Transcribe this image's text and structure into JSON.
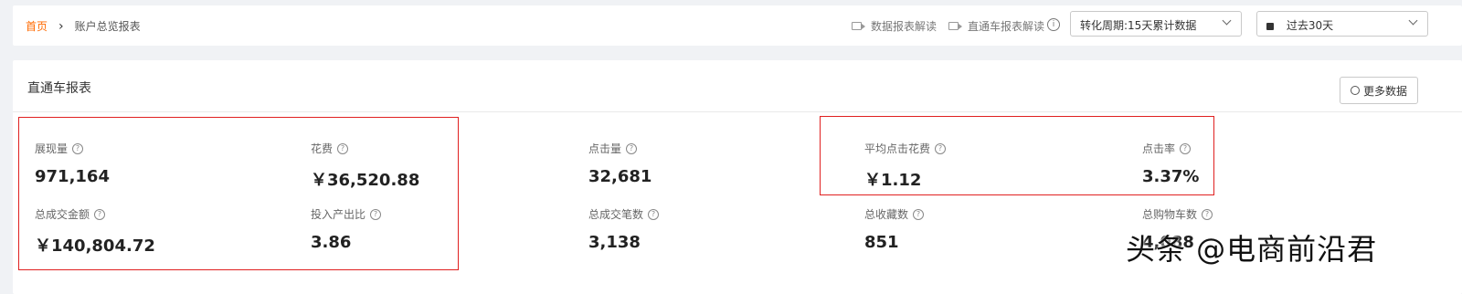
{
  "breadcrumb": {
    "home": "首页",
    "separator": "›",
    "current": "账户总览报表"
  },
  "toolbar": {
    "data_report_guide": "数据报表解读",
    "ztc_report_guide": "直通车报表解读",
    "info_icon": "i",
    "conversion_period": "转化周期:15天累计数据",
    "date_range": "过去30天"
  },
  "report": {
    "title": "直通车报表",
    "more_data": "更多数据",
    "help_mark": "?",
    "metrics": [
      {
        "label": "展现量",
        "value": "971,164"
      },
      {
        "label": "花费",
        "value": "￥36,520.88"
      },
      {
        "label": "点击量",
        "value": "32,681"
      },
      {
        "label": "平均点击花费",
        "value": "￥1.12"
      },
      {
        "label": "点击率",
        "value": "3.37%"
      },
      {
        "label": "总成交金额",
        "value": "￥140,804.72"
      },
      {
        "label": "投入产出比",
        "value": "3.86"
      },
      {
        "label": "总成交笔数",
        "value": "3,138"
      },
      {
        "label": "总收藏数",
        "value": "851"
      },
      {
        "label": "总购物车数",
        "value": "4,088"
      }
    ]
  },
  "watermark": "头条 @电商前沿君",
  "colors": {
    "accent": "#ff6a00",
    "highlight_box": "#e02020"
  },
  "icons": [
    "chevron-right-icon",
    "video-icon",
    "info-icon",
    "chevron-down-icon",
    "calendar-icon",
    "gear-icon",
    "help-icon"
  ]
}
